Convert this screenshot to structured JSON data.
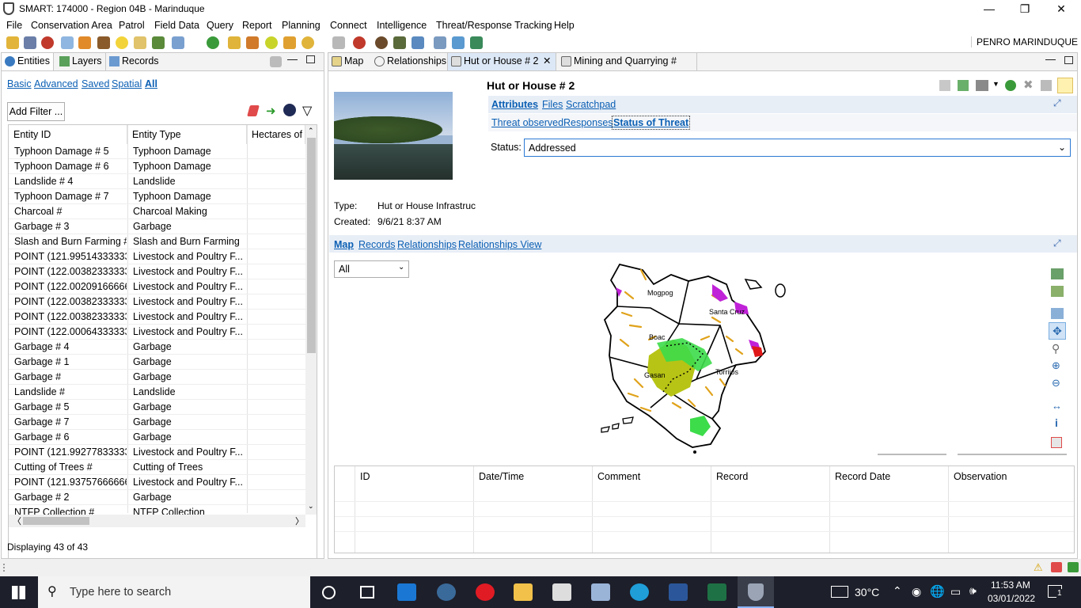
{
  "window": {
    "title": "SMART: 174000 - Region 04B - Marinduque"
  },
  "menu": [
    "File",
    "Conservation Area",
    "Patrol",
    "Field Data",
    "Query",
    "Report",
    "Planning",
    "Connect",
    "Intelligence",
    "Threat/Response Tracking",
    "Help"
  ],
  "toolbar": {
    "user_label": "PENRO MARINDUQUE"
  },
  "left_panel": {
    "tabs": [
      "Entities",
      "Layers",
      "Records"
    ],
    "filter_links": [
      "Basic",
      "Advanced",
      "Saved",
      "Spatial",
      "All"
    ],
    "active_filter": "All",
    "add_filter_label": "Add Filter ...",
    "columns": [
      "Entity ID",
      "Entity Type",
      "Hectares of I"
    ],
    "rows": [
      [
        "Typhoon Damage # 5",
        "Typhoon Damage"
      ],
      [
        "Typhoon Damage # 6",
        "Typhoon Damage"
      ],
      [
        "Landslide # 4",
        "Landslide"
      ],
      [
        "Typhoon Damage # 7",
        "Typhoon Damage"
      ],
      [
        "Charcoal #",
        "Charcoal Making"
      ],
      [
        "Garbage # 3",
        "Garbage"
      ],
      [
        "Slash and Burn Farming #",
        "Slash and Burn Farming"
      ],
      [
        "POINT (121.99514333333...",
        "Livestock and Poultry F..."
      ],
      [
        "POINT (122.00382333333...",
        "Livestock and Poultry F..."
      ],
      [
        "POINT (122.00209166666...",
        "Livestock and Poultry F..."
      ],
      [
        "POINT (122.00382333333...",
        "Livestock and Poultry F..."
      ],
      [
        "POINT (122.00382333333...",
        "Livestock and Poultry F..."
      ],
      [
        "POINT (122.00064333333...",
        "Livestock and Poultry F..."
      ],
      [
        "Garbage # 4",
        "Garbage"
      ],
      [
        "Garbage # 1",
        "Garbage"
      ],
      [
        "Garbage #",
        "Garbage"
      ],
      [
        "Landslide #",
        "Landslide"
      ],
      [
        "Garbage # 5",
        "Garbage"
      ],
      [
        "Garbage # 7",
        "Garbage"
      ],
      [
        "Garbage # 6",
        "Garbage"
      ],
      [
        "POINT (121.99277833333...",
        "Livestock and Poultry F..."
      ],
      [
        "Cutting of Trees #",
        "Cutting of Trees"
      ],
      [
        "POINT (121.93757666666...",
        "Livestock and Poultry F..."
      ],
      [
        "Garbage # 2",
        "Garbage"
      ],
      [
        "NTFP Collection #",
        "NTFP Collection"
      ]
    ],
    "footer": "Displaying 43 of 43"
  },
  "editor": {
    "tabs": [
      "Map",
      "Relationships",
      "Hut or House # 2",
      "Mining and Quarrying #"
    ],
    "active_tab": "Hut or House # 2",
    "entity_title": "Hut or House # 2",
    "section_links": [
      "Attributes",
      "Files",
      "Scratchpad"
    ],
    "sub_links": [
      "Threat observed",
      "Responses",
      "Status of Threat"
    ],
    "status_label": "Status:",
    "status_value": "Addressed",
    "type_label": "Type:",
    "type_value": "Hut or House Infrastruc",
    "created_label": "Created:",
    "created_value": "9/6/21 8:37 AM",
    "map_links": [
      "Map",
      "Records",
      "Relationships",
      "Relationships View"
    ],
    "map_filter": "All",
    "map_labels": [
      "Mogpog",
      "Santa Cruz",
      "Boac",
      "Torrijos",
      "Gasan"
    ],
    "record_columns": [
      "ID",
      "Date/Time",
      "Comment",
      "Record",
      "Record Date",
      "Observation"
    ]
  },
  "taskbar": {
    "search_placeholder": "Type here to search",
    "weather": "30°C",
    "time": "11:53 AM",
    "date": "03/01/2022",
    "notification_count": "1"
  },
  "colors": {
    "link": "#0b5fb4",
    "map_green": "#3ddc4a",
    "map_olive": "#b7c415",
    "map_orange": "#e0a21a",
    "map_purple": "#c022d8",
    "taskbar": "#1d1f2a"
  }
}
